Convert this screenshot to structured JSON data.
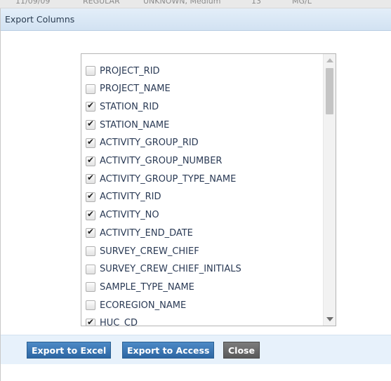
{
  "background": {
    "cells": [
      "11/09/09",
      "REGULAR",
      "UNKNOWN, Medium",
      "13",
      "MG/L"
    ]
  },
  "dialog": {
    "title": "Export Columns"
  },
  "columns": [
    {
      "label": "PROJECT_RID",
      "checked": false
    },
    {
      "label": "PROJECT_NAME",
      "checked": false
    },
    {
      "label": "STATION_RID",
      "checked": true
    },
    {
      "label": "STATION_NAME",
      "checked": true
    },
    {
      "label": "ACTIVITY_GROUP_RID",
      "checked": true
    },
    {
      "label": "ACTIVITY_GROUP_NUMBER",
      "checked": true
    },
    {
      "label": "ACTIVITY_GROUP_TYPE_NAME",
      "checked": true
    },
    {
      "label": "ACTIVITY_RID",
      "checked": true
    },
    {
      "label": "ACTIVITY_NO",
      "checked": true
    },
    {
      "label": "ACTIVITY_END_DATE",
      "checked": true
    },
    {
      "label": "SURVEY_CREW_CHIEF",
      "checked": false
    },
    {
      "label": "SURVEY_CREW_CHIEF_INITIALS",
      "checked": false
    },
    {
      "label": "SAMPLE_TYPE_NAME",
      "checked": false
    },
    {
      "label": "ECOREGION_NAME",
      "checked": false
    },
    {
      "label": "HUC_CD",
      "checked": true
    }
  ],
  "buttons": {
    "export_excel": "Export to Excel",
    "export_access": "Export to Access",
    "close": "Close"
  }
}
